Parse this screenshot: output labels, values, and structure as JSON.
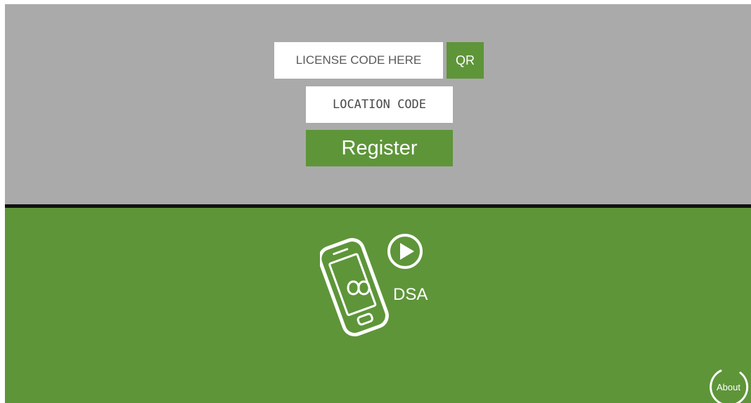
{
  "colors": {
    "top_background": "#aaaaaa",
    "divider": "#111111",
    "brand_green": "#5e9539",
    "field_background": "#ffffff",
    "text_on_green": "#ffffff"
  },
  "registration": {
    "license_placeholder": "LICENSE CODE HERE",
    "license_value": "",
    "qr_label": "QR",
    "location_placeholder": "LOCATION CODE",
    "location_value": "",
    "register_label": "Register"
  },
  "branding": {
    "app_name": "DSA",
    "phone_icon": "phone-icon",
    "infinity_icon": "infinity-icon",
    "play_icon": "play-icon"
  },
  "about": {
    "label": "About"
  }
}
